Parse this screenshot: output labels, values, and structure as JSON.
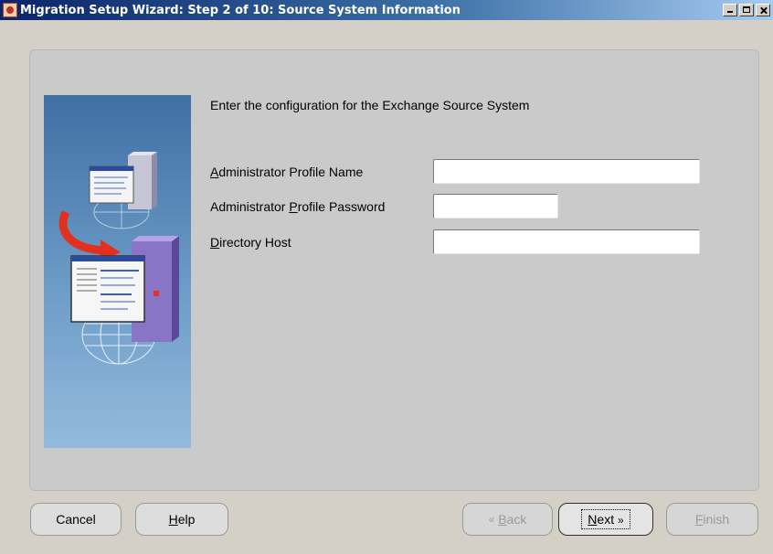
{
  "window": {
    "title": "Migration Setup Wizard:  Step 2 of 10: Source System Information",
    "controls": [
      "minimize",
      "maximize",
      "close"
    ]
  },
  "main": {
    "heading": "Enter the configuration for the Exchange Source System",
    "fields": [
      {
        "label_before": "",
        "mnemonic": "A",
        "label_after": "dministrator Profile Name",
        "value": ""
      },
      {
        "label_before": "Administrator ",
        "mnemonic": "P",
        "label_after": "rofile Password",
        "value": ""
      },
      {
        "label_before": "",
        "mnemonic": "D",
        "label_after": "irectory Host",
        "value": ""
      }
    ]
  },
  "buttons": {
    "cancel": "Cancel",
    "help_mnemonic": "H",
    "help_rest": "elp",
    "back_icon": "«",
    "back_mnemonic": "B",
    "back_rest": "ack",
    "next_mnemonic": "N",
    "next_rest": "ext",
    "next_icon": "»",
    "finish_mnemonic": "F",
    "finish_rest": "inish"
  },
  "colors": {
    "title_bar": "#0a246a",
    "background": "#d4d0c8",
    "panel": "#cacaca"
  }
}
